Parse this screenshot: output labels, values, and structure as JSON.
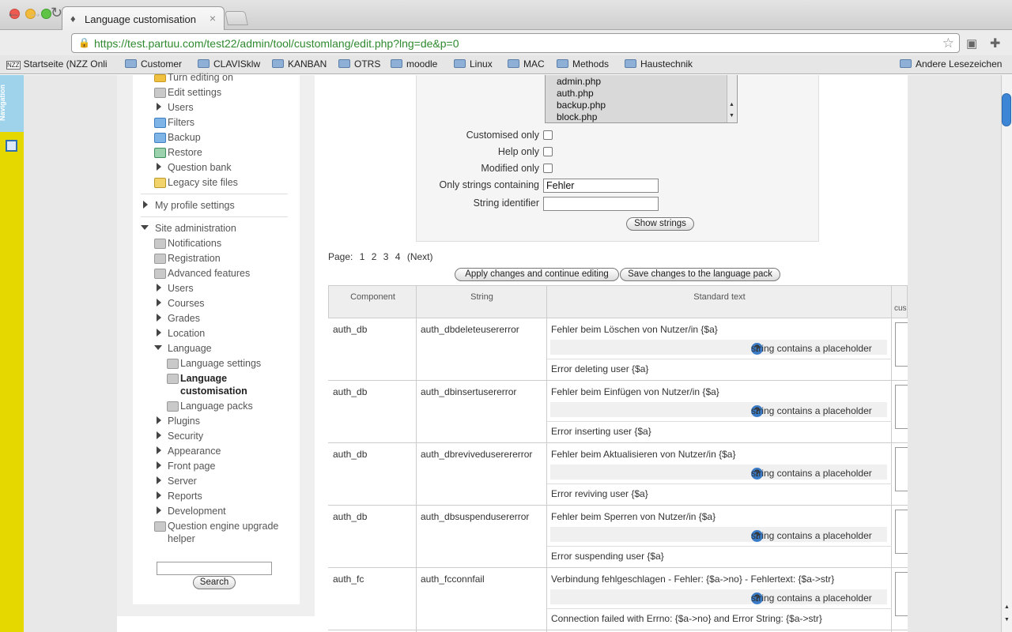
{
  "browser": {
    "tab_title": "Language customisation",
    "tab_close": "×",
    "url": "https://test.partuu.com/test22/admin/tool/customlang/edit.php?lng=de&p=0",
    "bookmarks": [
      "Startseite (NZZ Onli",
      "Customer",
      "CLAVISklw",
      "KANBAN",
      "OTRS",
      "moodle",
      "Linux",
      "MAC",
      "Methods",
      "Haustechnik"
    ],
    "other_bookmarks": "Andere Lesezeichen"
  },
  "rail": {
    "navigation_label": "Navigation"
  },
  "sidebar": {
    "items": [
      {
        "label": "Turn editing on"
      },
      {
        "label": "Edit settings"
      },
      {
        "label": "Users"
      },
      {
        "label": "Filters"
      },
      {
        "label": "Backup"
      },
      {
        "label": "Restore"
      },
      {
        "label": "Question bank"
      },
      {
        "label": "Legacy site files"
      },
      {
        "label": "My profile settings"
      },
      {
        "label": "Site administration"
      },
      {
        "label": "Notifications"
      },
      {
        "label": "Registration"
      },
      {
        "label": "Advanced features"
      },
      {
        "label": "Users"
      },
      {
        "label": "Courses"
      },
      {
        "label": "Grades"
      },
      {
        "label": "Location"
      },
      {
        "label": "Language"
      },
      {
        "label": "Language settings"
      },
      {
        "label": "Language"
      },
      {
        "label": "customisation"
      },
      {
        "label": "Language packs"
      },
      {
        "label": "Plugins"
      },
      {
        "label": "Security"
      },
      {
        "label": "Appearance"
      },
      {
        "label": "Front page"
      },
      {
        "label": "Server"
      },
      {
        "label": "Reports"
      },
      {
        "label": "Development"
      },
      {
        "label": "Question engine upgrade"
      },
      {
        "label": "helper"
      }
    ],
    "search_button": "Search",
    "search_value": ""
  },
  "filter": {
    "components": [
      "admin.php",
      "auth.php",
      "backup.php",
      "block.php"
    ],
    "customised_only": "Customised only",
    "help_only": "Help only",
    "modified_only": "Modified only",
    "only_strings_containing": "Only strings containing",
    "only_strings_value": "Fehler",
    "string_identifier": "String identifier",
    "string_identifier_value": "",
    "show_strings": "Show strings"
  },
  "paging": {
    "label": "Page:",
    "pages": [
      "1",
      "2",
      "3",
      "4"
    ],
    "next": "(Next)"
  },
  "actions": {
    "apply": "Apply changes and continue editing",
    "save": "Save changes to the language pack"
  },
  "table": {
    "headers": {
      "component": "Component",
      "string": "String",
      "standard": "Standard text",
      "custom_clip": "cus"
    },
    "rows": [
      {
        "component": "auth_db",
        "string": "auth_dbdeleteusererror",
        "master": "Fehler beim Löschen von Nutzer/in {$a}",
        "placeholder": "string contains a placeholder",
        "english": "Error deleting user {$a}"
      },
      {
        "component": "auth_db",
        "string": "auth_dbinsertusererror",
        "master": "Fehler beim Einfügen von Nutzer/in {$a}",
        "placeholder": "string contains a placeholder",
        "english": "Error inserting user {$a}"
      },
      {
        "component": "auth_db",
        "string": "auth_dbreviveduserererror",
        "master": "Fehler beim Aktualisieren von Nutzer/in {$a}",
        "placeholder": "string contains a placeholder",
        "english": "Error reviving user {$a}"
      },
      {
        "component": "auth_db",
        "string": "auth_dbsuspendusererror",
        "master": "Fehler beim Sperren von Nutzer/in {$a}",
        "placeholder": "string contains a placeholder",
        "english": "Error suspending user {$a}"
      },
      {
        "component": "auth_fc",
        "string": "auth_fcconnfail",
        "master": "Verbindung fehlgeschlagen - Fehler: {$a->no} - Fehlertext: {$a->str}",
        "placeholder": "string contains a placeholder",
        "english": "Connection failed with Errno: {$a->no} and Error String: {$a->str}"
      }
    ]
  }
}
